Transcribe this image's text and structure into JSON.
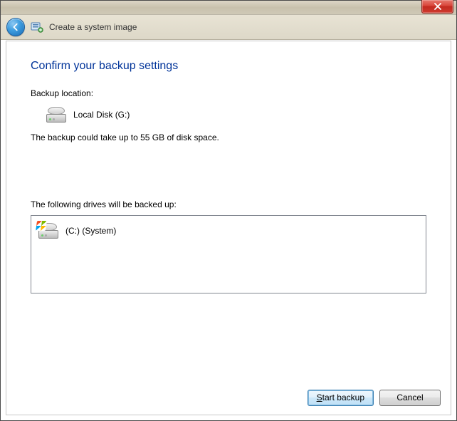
{
  "window": {
    "title": "Create a system image"
  },
  "page": {
    "heading": "Confirm your backup settings",
    "backup_location_label": "Backup location:",
    "backup_location_value": "Local Disk (G:)",
    "size_estimate": "The backup could take up to 55 GB of disk space.",
    "drives_label": "The following drives will be backed up:",
    "drives": [
      {
        "label": "(C:) (System)"
      }
    ]
  },
  "buttons": {
    "start_backup": "Start backup",
    "cancel": "Cancel"
  }
}
